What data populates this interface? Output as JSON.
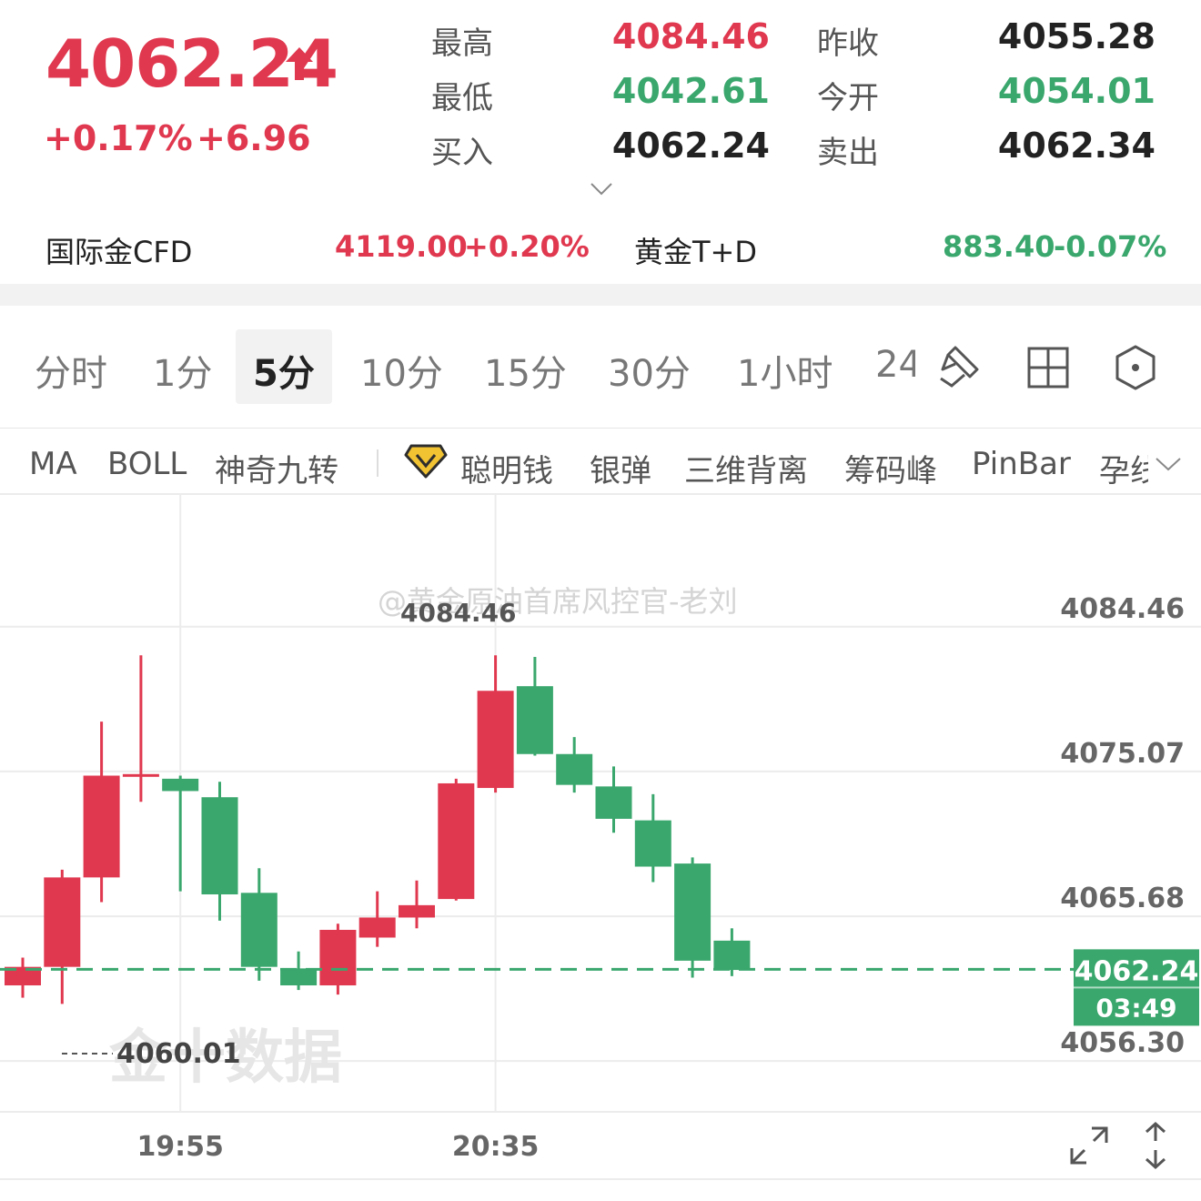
{
  "header": {
    "price": "4062.24",
    "change_pct": "+0.17%",
    "change_abs": "+6.96",
    "stats": {
      "high_label": "最高",
      "high_value": "4084.46",
      "prev_close_label": "昨收",
      "prev_close_value": "4055.28",
      "low_label": "最低",
      "low_value": "4042.61",
      "open_label": "今开",
      "open_value": "4054.01",
      "bid_label": "买入",
      "bid_value": "4062.24",
      "ask_label": "卖出",
      "ask_value": "4062.34"
    },
    "related": {
      "cfd_label": "国际金CFD",
      "cfd_value": "4119.00",
      "cfd_change": "+0.20%",
      "td_label": "黄金T+D",
      "td_value": "883.40",
      "td_change": "-0.07%"
    }
  },
  "periods": {
    "items": [
      "分时",
      "1分",
      "5分",
      "10分",
      "15分",
      "30分",
      "1小时",
      "24"
    ],
    "selected": "5分"
  },
  "indicators": {
    "items": [
      "MA",
      "BOLL",
      "神奇九转"
    ],
    "premium_items": [
      "聪明钱",
      "银弹",
      "三维背离",
      "筹码峰",
      "PinBar",
      "孕线"
    ]
  },
  "watermarks": {
    "weibo": "@黄金原油首席风控官-老刘",
    "brand": "金十数据"
  },
  "chart_data": {
    "type": "candlestick",
    "interval": "5分",
    "y_axis_ticks": [
      "4084.46",
      "4075.07",
      "4065.68",
      "4056.30"
    ],
    "ylim": [
      4053.0,
      4093.0
    ],
    "x_axis_ticks": [
      {
        "index": 4,
        "label": "19:55"
      },
      {
        "index": 12,
        "label": "20:35"
      }
    ],
    "current_price": 4062.24,
    "current_price_label": "4062.24",
    "countdown": "03:49",
    "high_annotation": "4084.46",
    "low_annotation": "4060.01",
    "candles": [
      {
        "open": 4061.2,
        "close": 4062.4,
        "high": 4063.0,
        "low": 4060.4
      },
      {
        "open": 4062.4,
        "close": 4068.2,
        "high": 4068.7,
        "low": 4060.0
      },
      {
        "open": 4068.2,
        "close": 4074.8,
        "high": 4078.3,
        "low": 4066.6
      },
      {
        "open": 4074.9,
        "close": 4074.9,
        "high": 4082.6,
        "low": 4073.1
      },
      {
        "open": 4074.6,
        "close": 4073.8,
        "high": 4074.8,
        "low": 4067.3
      },
      {
        "open": 4073.4,
        "close": 4067.1,
        "high": 4074.4,
        "low": 4065.4
      },
      {
        "open": 4067.2,
        "close": 4062.4,
        "high": 4068.8,
        "low": 4061.5
      },
      {
        "open": 4062.3,
        "close": 4061.2,
        "high": 4063.4,
        "low": 4060.9
      },
      {
        "open": 4061.2,
        "close": 4064.8,
        "high": 4065.2,
        "low": 4060.6
      },
      {
        "open": 4064.3,
        "close": 4065.6,
        "high": 4067.3,
        "low": 4063.7
      },
      {
        "open": 4065.6,
        "close": 4066.4,
        "high": 4068.0,
        "low": 4064.9
      },
      {
        "open": 4066.8,
        "close": 4074.3,
        "high": 4074.6,
        "low": 4066.7
      },
      {
        "open": 4074.0,
        "close": 4080.3,
        "high": 4082.6,
        "low": 4073.7
      },
      {
        "open": 4080.6,
        "close": 4076.2,
        "high": 4082.5,
        "low": 4076.1
      },
      {
        "open": 4076.2,
        "close": 4074.2,
        "high": 4077.3,
        "low": 4073.7
      },
      {
        "open": 4074.1,
        "close": 4072.0,
        "high": 4075.4,
        "low": 4071.1
      },
      {
        "open": 4071.9,
        "close": 4068.9,
        "high": 4073.6,
        "low": 4067.9
      },
      {
        "open": 4069.1,
        "close": 4062.8,
        "high": 4069.5,
        "low": 4061.7
      },
      {
        "open": 4064.1,
        "close": 4062.2,
        "high": 4064.9,
        "low": 4061.8
      }
    ]
  },
  "colors": {
    "up": "#e0384f",
    "down": "#3aa76d",
    "grid": "#ececec",
    "axis_text": "#666666",
    "current_price_bg": "#3aa76d",
    "tab_selected_bg": "#f2f2f2"
  },
  "icons": {
    "price_arrow": "arrow-up-icon",
    "expand": "chevron-down-icon",
    "draw_tool": "pen-draw-icon",
    "layout": "grid-layout-icon",
    "settings": "hexagon-settings-icon",
    "premium": "diamond-icon",
    "more": "chevron-down-icon",
    "fullscreen": "expand-diagonal-icon",
    "vertical_scale": "vertical-resize-icon"
  }
}
